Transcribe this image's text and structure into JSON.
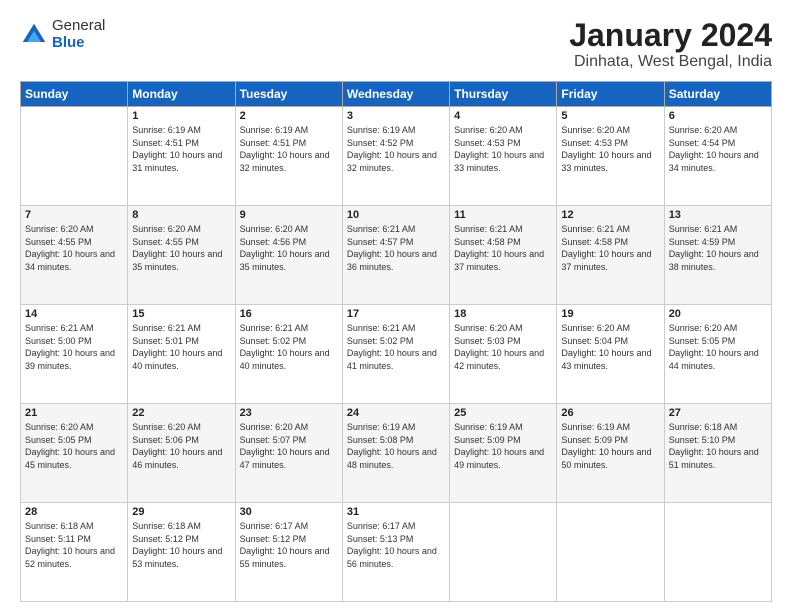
{
  "logo": {
    "general": "General",
    "blue": "Blue"
  },
  "header": {
    "month": "January 2024",
    "location": "Dinhata, West Bengal, India"
  },
  "weekdays": [
    "Sunday",
    "Monday",
    "Tuesday",
    "Wednesday",
    "Thursday",
    "Friday",
    "Saturday"
  ],
  "weeks": [
    [
      {
        "day": "",
        "sunrise": "",
        "sunset": "",
        "daylight": ""
      },
      {
        "day": "1",
        "sunrise": "Sunrise: 6:19 AM",
        "sunset": "Sunset: 4:51 PM",
        "daylight": "Daylight: 10 hours and 31 minutes."
      },
      {
        "day": "2",
        "sunrise": "Sunrise: 6:19 AM",
        "sunset": "Sunset: 4:51 PM",
        "daylight": "Daylight: 10 hours and 32 minutes."
      },
      {
        "day": "3",
        "sunrise": "Sunrise: 6:19 AM",
        "sunset": "Sunset: 4:52 PM",
        "daylight": "Daylight: 10 hours and 32 minutes."
      },
      {
        "day": "4",
        "sunrise": "Sunrise: 6:20 AM",
        "sunset": "Sunset: 4:53 PM",
        "daylight": "Daylight: 10 hours and 33 minutes."
      },
      {
        "day": "5",
        "sunrise": "Sunrise: 6:20 AM",
        "sunset": "Sunset: 4:53 PM",
        "daylight": "Daylight: 10 hours and 33 minutes."
      },
      {
        "day": "6",
        "sunrise": "Sunrise: 6:20 AM",
        "sunset": "Sunset: 4:54 PM",
        "daylight": "Daylight: 10 hours and 34 minutes."
      }
    ],
    [
      {
        "day": "7",
        "sunrise": "Sunrise: 6:20 AM",
        "sunset": "Sunset: 4:55 PM",
        "daylight": "Daylight: 10 hours and 34 minutes."
      },
      {
        "day": "8",
        "sunrise": "Sunrise: 6:20 AM",
        "sunset": "Sunset: 4:55 PM",
        "daylight": "Daylight: 10 hours and 35 minutes."
      },
      {
        "day": "9",
        "sunrise": "Sunrise: 6:20 AM",
        "sunset": "Sunset: 4:56 PM",
        "daylight": "Daylight: 10 hours and 35 minutes."
      },
      {
        "day": "10",
        "sunrise": "Sunrise: 6:21 AM",
        "sunset": "Sunset: 4:57 PM",
        "daylight": "Daylight: 10 hours and 36 minutes."
      },
      {
        "day": "11",
        "sunrise": "Sunrise: 6:21 AM",
        "sunset": "Sunset: 4:58 PM",
        "daylight": "Daylight: 10 hours and 37 minutes."
      },
      {
        "day": "12",
        "sunrise": "Sunrise: 6:21 AM",
        "sunset": "Sunset: 4:58 PM",
        "daylight": "Daylight: 10 hours and 37 minutes."
      },
      {
        "day": "13",
        "sunrise": "Sunrise: 6:21 AM",
        "sunset": "Sunset: 4:59 PM",
        "daylight": "Daylight: 10 hours and 38 minutes."
      }
    ],
    [
      {
        "day": "14",
        "sunrise": "Sunrise: 6:21 AM",
        "sunset": "Sunset: 5:00 PM",
        "daylight": "Daylight: 10 hours and 39 minutes."
      },
      {
        "day": "15",
        "sunrise": "Sunrise: 6:21 AM",
        "sunset": "Sunset: 5:01 PM",
        "daylight": "Daylight: 10 hours and 40 minutes."
      },
      {
        "day": "16",
        "sunrise": "Sunrise: 6:21 AM",
        "sunset": "Sunset: 5:02 PM",
        "daylight": "Daylight: 10 hours and 40 minutes."
      },
      {
        "day": "17",
        "sunrise": "Sunrise: 6:21 AM",
        "sunset": "Sunset: 5:02 PM",
        "daylight": "Daylight: 10 hours and 41 minutes."
      },
      {
        "day": "18",
        "sunrise": "Sunrise: 6:20 AM",
        "sunset": "Sunset: 5:03 PM",
        "daylight": "Daylight: 10 hours and 42 minutes."
      },
      {
        "day": "19",
        "sunrise": "Sunrise: 6:20 AM",
        "sunset": "Sunset: 5:04 PM",
        "daylight": "Daylight: 10 hours and 43 minutes."
      },
      {
        "day": "20",
        "sunrise": "Sunrise: 6:20 AM",
        "sunset": "Sunset: 5:05 PM",
        "daylight": "Daylight: 10 hours and 44 minutes."
      }
    ],
    [
      {
        "day": "21",
        "sunrise": "Sunrise: 6:20 AM",
        "sunset": "Sunset: 5:05 PM",
        "daylight": "Daylight: 10 hours and 45 minutes."
      },
      {
        "day": "22",
        "sunrise": "Sunrise: 6:20 AM",
        "sunset": "Sunset: 5:06 PM",
        "daylight": "Daylight: 10 hours and 46 minutes."
      },
      {
        "day": "23",
        "sunrise": "Sunrise: 6:20 AM",
        "sunset": "Sunset: 5:07 PM",
        "daylight": "Daylight: 10 hours and 47 minutes."
      },
      {
        "day": "24",
        "sunrise": "Sunrise: 6:19 AM",
        "sunset": "Sunset: 5:08 PM",
        "daylight": "Daylight: 10 hours and 48 minutes."
      },
      {
        "day": "25",
        "sunrise": "Sunrise: 6:19 AM",
        "sunset": "Sunset: 5:09 PM",
        "daylight": "Daylight: 10 hours and 49 minutes."
      },
      {
        "day": "26",
        "sunrise": "Sunrise: 6:19 AM",
        "sunset": "Sunset: 5:09 PM",
        "daylight": "Daylight: 10 hours and 50 minutes."
      },
      {
        "day": "27",
        "sunrise": "Sunrise: 6:18 AM",
        "sunset": "Sunset: 5:10 PM",
        "daylight": "Daylight: 10 hours and 51 minutes."
      }
    ],
    [
      {
        "day": "28",
        "sunrise": "Sunrise: 6:18 AM",
        "sunset": "Sunset: 5:11 PM",
        "daylight": "Daylight: 10 hours and 52 minutes."
      },
      {
        "day": "29",
        "sunrise": "Sunrise: 6:18 AM",
        "sunset": "Sunset: 5:12 PM",
        "daylight": "Daylight: 10 hours and 53 minutes."
      },
      {
        "day": "30",
        "sunrise": "Sunrise: 6:17 AM",
        "sunset": "Sunset: 5:12 PM",
        "daylight": "Daylight: 10 hours and 55 minutes."
      },
      {
        "day": "31",
        "sunrise": "Sunrise: 6:17 AM",
        "sunset": "Sunset: 5:13 PM",
        "daylight": "Daylight: 10 hours and 56 minutes."
      },
      {
        "day": "",
        "sunrise": "",
        "sunset": "",
        "daylight": ""
      },
      {
        "day": "",
        "sunrise": "",
        "sunset": "",
        "daylight": ""
      },
      {
        "day": "",
        "sunrise": "",
        "sunset": "",
        "daylight": ""
      }
    ]
  ]
}
